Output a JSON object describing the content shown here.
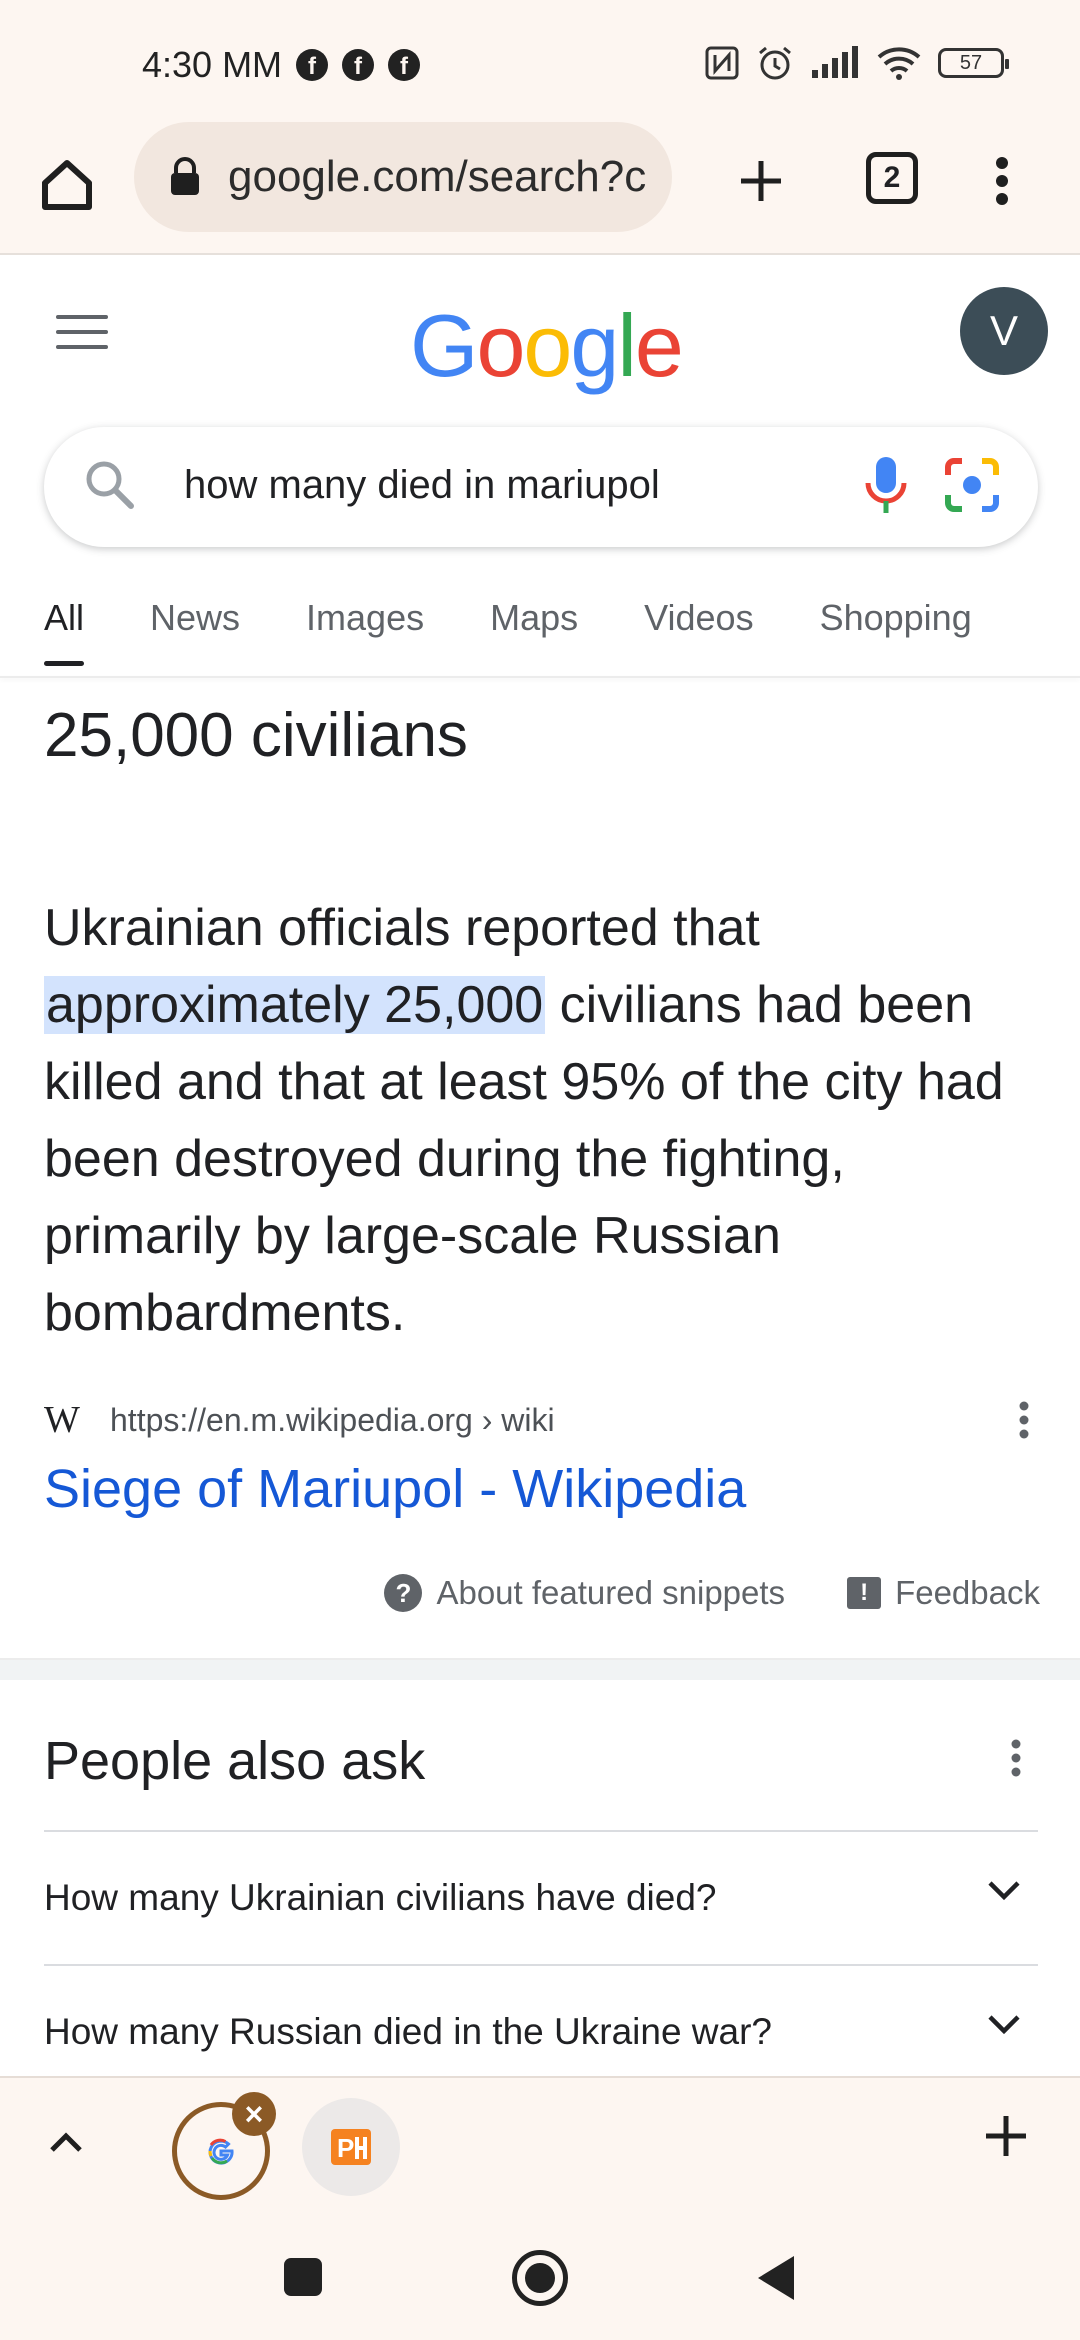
{
  "status_bar": {
    "time": "4:30 MM",
    "notification_icons": [
      "facebook-icon",
      "facebook-icon",
      "facebook-icon"
    ],
    "right_icons": [
      "nfc-icon",
      "alarm-icon",
      "signal-icon",
      "wifi-icon"
    ],
    "battery": "57"
  },
  "browser": {
    "url": "google.com/search?c",
    "tab_count": "2"
  },
  "google": {
    "logo": [
      "G",
      "o",
      "o",
      "g",
      "l",
      "e"
    ],
    "logo_colors": [
      "#4285F4",
      "#EA4335",
      "#FBBC05",
      "#4285F4",
      "#34A853",
      "#EA4335"
    ],
    "avatar_letter": "V",
    "search_query": "how many died in mariupol",
    "tabs": [
      "All",
      "News",
      "Images",
      "Maps",
      "Videos",
      "Shopping"
    ],
    "active_tab": "All"
  },
  "featured_snippet": {
    "answer": "25,000 civilians",
    "text_before": "Ukrainian officials reported that ",
    "text_highlight": "approximately 25,000",
    "text_after": " civilians had been killed and that at least 95% of the city had been destroyed during the fighting, primarily by large-scale Russian bombardments.",
    "source_logo": "W",
    "source_url": "https://en.m.wikipedia.org › wiki",
    "title": "Siege of Mariupol - Wikipedia",
    "about_label": "About featured snippets",
    "feedback_label": "Feedback"
  },
  "people_also_ask": {
    "title": "People also ask",
    "questions": [
      "How many Ukrainian civilians have died?",
      "How many Russian died in the Ukraine war?"
    ]
  },
  "tab_strip": {
    "tabs": [
      "google-tab",
      "presentation-app-tab"
    ]
  },
  "colors": {
    "accent_link": "#1558d6",
    "highlight": "#d3e3fd",
    "chrome_bg": "#fdf6f1",
    "tab_ring": "#8b5a26"
  }
}
